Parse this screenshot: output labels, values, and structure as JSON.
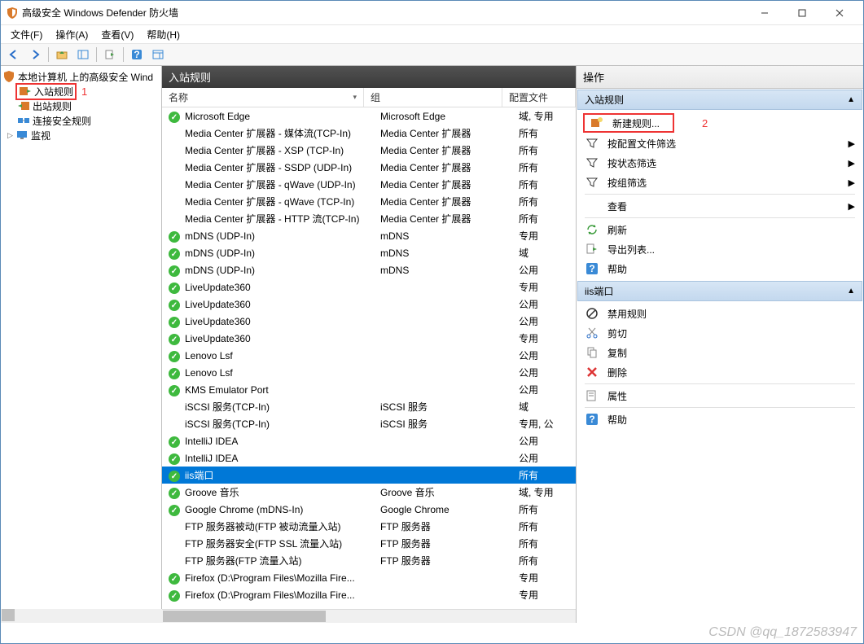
{
  "window": {
    "title": "高级安全 Windows Defender 防火墙"
  },
  "menu": {
    "file": "文件(F)",
    "action": "操作(A)",
    "view": "查看(V)",
    "help": "帮助(H)"
  },
  "tree": {
    "root": "本地计算机 上的高级安全 Wind",
    "inbound": "入站规则",
    "outbound": "出站规则",
    "connsec": "连接安全规则",
    "monitor": "监视"
  },
  "annotations": {
    "one": "1",
    "two": "2"
  },
  "middle": {
    "header": "入站规则",
    "cols": {
      "name": "名称",
      "group": "组",
      "profile": "配置文件"
    },
    "rules": [
      {
        "ico": "green",
        "name": "Microsoft Edge",
        "group": "Microsoft Edge",
        "profile": "域, 专用"
      },
      {
        "ico": "none",
        "name": "Media Center 扩展器 - 媒体流(TCP-In)",
        "group": "Media Center 扩展器",
        "profile": "所有"
      },
      {
        "ico": "none",
        "name": "Media Center 扩展器 - XSP (TCP-In)",
        "group": "Media Center 扩展器",
        "profile": "所有"
      },
      {
        "ico": "none",
        "name": "Media Center 扩展器 - SSDP (UDP-In)",
        "group": "Media Center 扩展器",
        "profile": "所有"
      },
      {
        "ico": "none",
        "name": "Media Center 扩展器 - qWave (UDP-In)",
        "group": "Media Center 扩展器",
        "profile": "所有"
      },
      {
        "ico": "none",
        "name": "Media Center 扩展器 - qWave (TCP-In)",
        "group": "Media Center 扩展器",
        "profile": "所有"
      },
      {
        "ico": "none",
        "name": "Media Center 扩展器 - HTTP 流(TCP-In)",
        "group": "Media Center 扩展器",
        "profile": "所有"
      },
      {
        "ico": "green",
        "name": "mDNS (UDP-In)",
        "group": "mDNS",
        "profile": "专用"
      },
      {
        "ico": "green",
        "name": "mDNS (UDP-In)",
        "group": "mDNS",
        "profile": "域"
      },
      {
        "ico": "green",
        "name": "mDNS (UDP-In)",
        "group": "mDNS",
        "profile": "公用"
      },
      {
        "ico": "green",
        "name": "LiveUpdate360",
        "group": "",
        "profile": "专用"
      },
      {
        "ico": "green",
        "name": "LiveUpdate360",
        "group": "",
        "profile": "公用"
      },
      {
        "ico": "green",
        "name": "LiveUpdate360",
        "group": "",
        "profile": "公用"
      },
      {
        "ico": "green",
        "name": "LiveUpdate360",
        "group": "",
        "profile": "专用"
      },
      {
        "ico": "green",
        "name": "Lenovo Lsf",
        "group": "",
        "profile": "公用"
      },
      {
        "ico": "green",
        "name": "Lenovo Lsf",
        "group": "",
        "profile": "公用"
      },
      {
        "ico": "green",
        "name": "KMS Emulator Port",
        "group": "",
        "profile": "公用"
      },
      {
        "ico": "none",
        "name": "iSCSI 服务(TCP-In)",
        "group": "iSCSI 服务",
        "profile": "域"
      },
      {
        "ico": "none",
        "name": "iSCSI 服务(TCP-In)",
        "group": "iSCSI 服务",
        "profile": "专用, 公"
      },
      {
        "ico": "green",
        "name": "IntelliJ IDEA",
        "group": "",
        "profile": "公用"
      },
      {
        "ico": "green",
        "name": "IntelliJ IDEA",
        "group": "",
        "profile": "公用"
      },
      {
        "ico": "green",
        "name": "iis端口",
        "group": "",
        "profile": "所有",
        "selected": true
      },
      {
        "ico": "green",
        "name": "Groove 音乐",
        "group": "Groove 音乐",
        "profile": "域, 专用"
      },
      {
        "ico": "green",
        "name": "Google Chrome (mDNS-In)",
        "group": "Google Chrome",
        "profile": "所有"
      },
      {
        "ico": "none",
        "name": "FTP 服务器被动(FTP 被动流量入站)",
        "group": "FTP 服务器",
        "profile": "所有"
      },
      {
        "ico": "none",
        "name": "FTP 服务器安全(FTP SSL 流量入站)",
        "group": "FTP 服务器",
        "profile": "所有"
      },
      {
        "ico": "none",
        "name": "FTP 服务器(FTP 流量入站)",
        "group": "FTP 服务器",
        "profile": "所有"
      },
      {
        "ico": "green",
        "name": "Firefox (D:\\Program Files\\Mozilla Fire...",
        "group": "",
        "profile": "专用"
      },
      {
        "ico": "green",
        "name": "Firefox (D:\\Program Files\\Mozilla Fire...",
        "group": "",
        "profile": "专用"
      }
    ]
  },
  "actions": {
    "header": "操作",
    "section1": "入站规则",
    "new_rule": "新建规则...",
    "filter_profile": "按配置文件筛选",
    "filter_state": "按状态筛选",
    "filter_group": "按组筛选",
    "view": "查看",
    "refresh": "刷新",
    "export": "导出列表...",
    "help": "帮助",
    "section2": "iis端口",
    "disable": "禁用规则",
    "cut": "剪切",
    "copy": "复制",
    "delete": "删除",
    "properties": "属性",
    "help2": "帮助"
  },
  "watermark": "CSDN @qq_1872583947"
}
